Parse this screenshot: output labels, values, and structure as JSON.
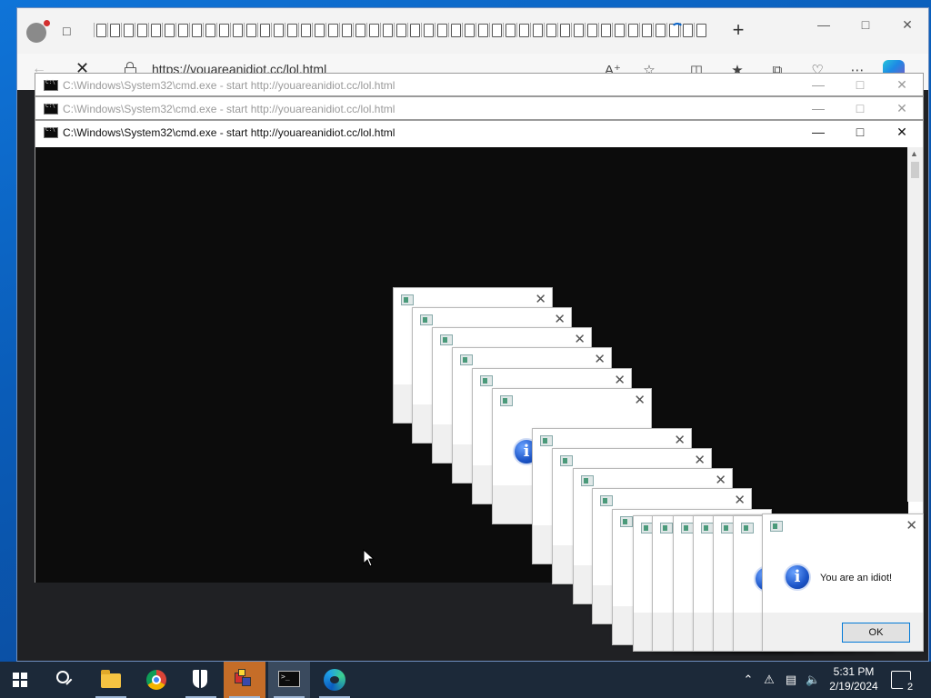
{
  "browser": {
    "url": "https://youareanidiot.cc/lol.html",
    "tab_count_visible": 45
  },
  "cmd_windows": [
    {
      "title": "C:\\Windows\\System32\\cmd.exe - start  http://youareanidiot.cc/lol.html",
      "state": "inactive"
    },
    {
      "title": "C:\\Windows\\System32\\cmd.exe - start  http://youareanidiot.cc/lol.html",
      "state": "inactive"
    },
    {
      "title": "C:\\Windows\\System32\\cmd.exe - start  http://youareanidiot.cc/lol.html",
      "state": "active"
    }
  ],
  "message_box": {
    "text": "You are an idiot!",
    "ok_label": "OK",
    "icon": "info-icon"
  },
  "taskbar": {
    "apps": [
      "start-icon",
      "search-icon",
      "file-explorer-icon",
      "chrome-icon",
      "windows-security-icon",
      "setup-icon",
      "cmd-icon",
      "edge-icon"
    ],
    "time": "5:31 PM",
    "date": "2/19/2024",
    "notification_count": "2"
  },
  "colors": {
    "desktop": "#0a66c4",
    "taskbar": "#1c2939",
    "console": "#0c0c0c",
    "ok_border": "#0078d7"
  }
}
